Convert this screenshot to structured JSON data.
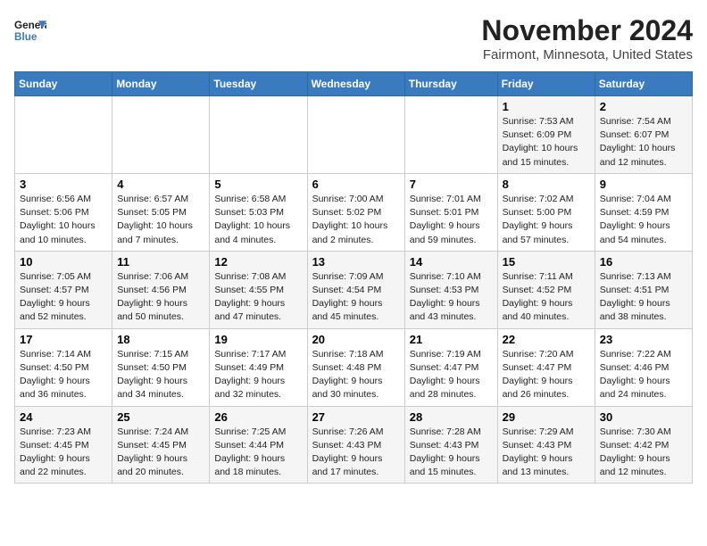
{
  "header": {
    "logo_line1": "General",
    "logo_line2": "Blue",
    "title": "November 2024",
    "subtitle": "Fairmont, Minnesota, United States"
  },
  "weekdays": [
    "Sunday",
    "Monday",
    "Tuesday",
    "Wednesday",
    "Thursday",
    "Friday",
    "Saturday"
  ],
  "weeks": [
    [
      {
        "day": "",
        "info": ""
      },
      {
        "day": "",
        "info": ""
      },
      {
        "day": "",
        "info": ""
      },
      {
        "day": "",
        "info": ""
      },
      {
        "day": "",
        "info": ""
      },
      {
        "day": "1",
        "info": "Sunrise: 7:53 AM\nSunset: 6:09 PM\nDaylight: 10 hours\nand 15 minutes."
      },
      {
        "day": "2",
        "info": "Sunrise: 7:54 AM\nSunset: 6:07 PM\nDaylight: 10 hours\nand 12 minutes."
      }
    ],
    [
      {
        "day": "3",
        "info": "Sunrise: 6:56 AM\nSunset: 5:06 PM\nDaylight: 10 hours\nand 10 minutes."
      },
      {
        "day": "4",
        "info": "Sunrise: 6:57 AM\nSunset: 5:05 PM\nDaylight: 10 hours\nand 7 minutes."
      },
      {
        "day": "5",
        "info": "Sunrise: 6:58 AM\nSunset: 5:03 PM\nDaylight: 10 hours\nand 4 minutes."
      },
      {
        "day": "6",
        "info": "Sunrise: 7:00 AM\nSunset: 5:02 PM\nDaylight: 10 hours\nand 2 minutes."
      },
      {
        "day": "7",
        "info": "Sunrise: 7:01 AM\nSunset: 5:01 PM\nDaylight: 9 hours\nand 59 minutes."
      },
      {
        "day": "8",
        "info": "Sunrise: 7:02 AM\nSunset: 5:00 PM\nDaylight: 9 hours\nand 57 minutes."
      },
      {
        "day": "9",
        "info": "Sunrise: 7:04 AM\nSunset: 4:59 PM\nDaylight: 9 hours\nand 54 minutes."
      }
    ],
    [
      {
        "day": "10",
        "info": "Sunrise: 7:05 AM\nSunset: 4:57 PM\nDaylight: 9 hours\nand 52 minutes."
      },
      {
        "day": "11",
        "info": "Sunrise: 7:06 AM\nSunset: 4:56 PM\nDaylight: 9 hours\nand 50 minutes."
      },
      {
        "day": "12",
        "info": "Sunrise: 7:08 AM\nSunset: 4:55 PM\nDaylight: 9 hours\nand 47 minutes."
      },
      {
        "day": "13",
        "info": "Sunrise: 7:09 AM\nSunset: 4:54 PM\nDaylight: 9 hours\nand 45 minutes."
      },
      {
        "day": "14",
        "info": "Sunrise: 7:10 AM\nSunset: 4:53 PM\nDaylight: 9 hours\nand 43 minutes."
      },
      {
        "day": "15",
        "info": "Sunrise: 7:11 AM\nSunset: 4:52 PM\nDaylight: 9 hours\nand 40 minutes."
      },
      {
        "day": "16",
        "info": "Sunrise: 7:13 AM\nSunset: 4:51 PM\nDaylight: 9 hours\nand 38 minutes."
      }
    ],
    [
      {
        "day": "17",
        "info": "Sunrise: 7:14 AM\nSunset: 4:50 PM\nDaylight: 9 hours\nand 36 minutes."
      },
      {
        "day": "18",
        "info": "Sunrise: 7:15 AM\nSunset: 4:50 PM\nDaylight: 9 hours\nand 34 minutes."
      },
      {
        "day": "19",
        "info": "Sunrise: 7:17 AM\nSunset: 4:49 PM\nDaylight: 9 hours\nand 32 minutes."
      },
      {
        "day": "20",
        "info": "Sunrise: 7:18 AM\nSunset: 4:48 PM\nDaylight: 9 hours\nand 30 minutes."
      },
      {
        "day": "21",
        "info": "Sunrise: 7:19 AM\nSunset: 4:47 PM\nDaylight: 9 hours\nand 28 minutes."
      },
      {
        "day": "22",
        "info": "Sunrise: 7:20 AM\nSunset: 4:47 PM\nDaylight: 9 hours\nand 26 minutes."
      },
      {
        "day": "23",
        "info": "Sunrise: 7:22 AM\nSunset: 4:46 PM\nDaylight: 9 hours\nand 24 minutes."
      }
    ],
    [
      {
        "day": "24",
        "info": "Sunrise: 7:23 AM\nSunset: 4:45 PM\nDaylight: 9 hours\nand 22 minutes."
      },
      {
        "day": "25",
        "info": "Sunrise: 7:24 AM\nSunset: 4:45 PM\nDaylight: 9 hours\nand 20 minutes."
      },
      {
        "day": "26",
        "info": "Sunrise: 7:25 AM\nSunset: 4:44 PM\nDaylight: 9 hours\nand 18 minutes."
      },
      {
        "day": "27",
        "info": "Sunrise: 7:26 AM\nSunset: 4:43 PM\nDaylight: 9 hours\nand 17 minutes."
      },
      {
        "day": "28",
        "info": "Sunrise: 7:28 AM\nSunset: 4:43 PM\nDaylight: 9 hours\nand 15 minutes."
      },
      {
        "day": "29",
        "info": "Sunrise: 7:29 AM\nSunset: 4:43 PM\nDaylight: 9 hours\nand 13 minutes."
      },
      {
        "day": "30",
        "info": "Sunrise: 7:30 AM\nSunset: 4:42 PM\nDaylight: 9 hours\nand 12 minutes."
      }
    ]
  ]
}
